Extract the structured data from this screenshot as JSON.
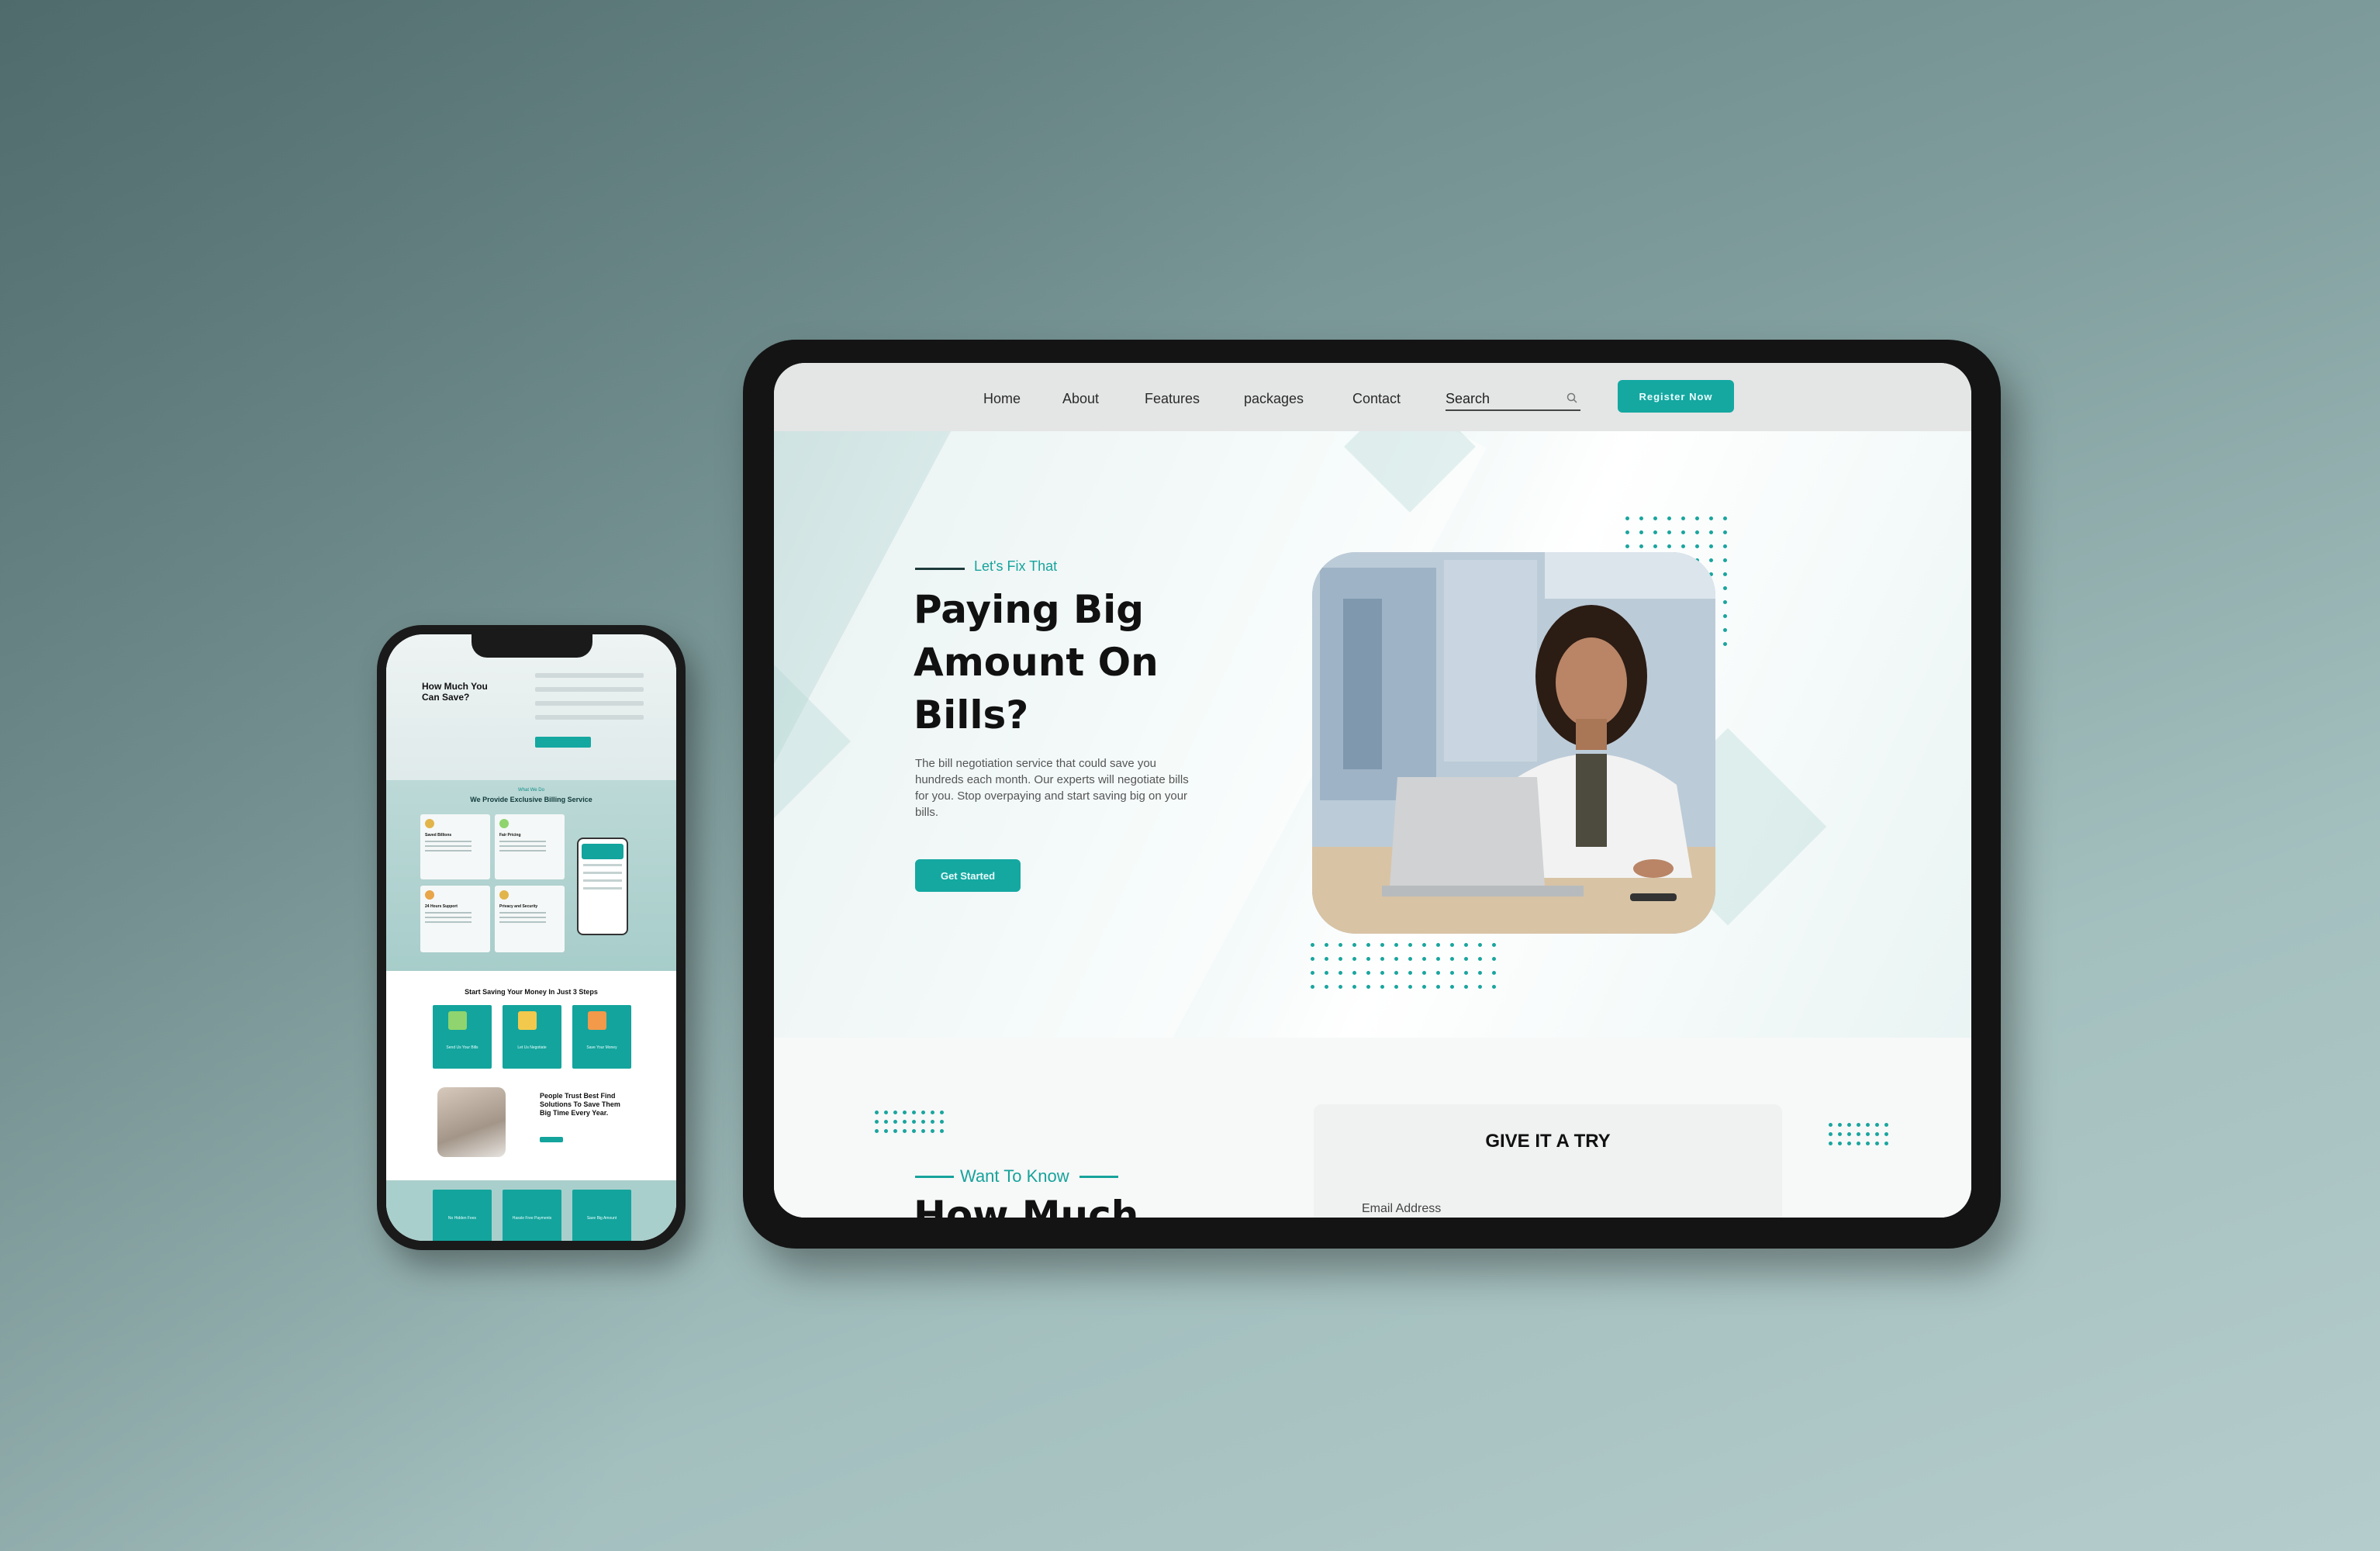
{
  "nav": {
    "items": [
      "Home",
      "About",
      "Features",
      "packages",
      "Contact"
    ],
    "search_label": "Search",
    "register_label": "Register Now"
  },
  "hero": {
    "eyebrow": "Let's Fix That",
    "title": "Paying Big Amount On Bills?",
    "text": "The bill negotiation service that could save you hundreds each month. Our experts will negotiate bills for you. Stop overpaying and start saving big on your bills.",
    "button_label": "Get Started"
  },
  "section2": {
    "eyebrow": "Want To Know",
    "title_partial": "How Much",
    "form_title": "GIVE IT A TRY",
    "email_label": "Email Address"
  },
  "phone": {
    "save_title": "How Much You Can Save?",
    "services_eyebrow": "What We Do",
    "services_title": "We Provide Exclusive Billing Service",
    "service_cards": [
      "Saved Billions",
      "Fair Pricing",
      "24 Hours Support",
      "Privacy and Security"
    ],
    "steps_title": "Start Saving Your Money In Just 3 Steps",
    "steps": [
      "Send Us Your Bills",
      "Let Us Negotiate",
      "Save Your Money"
    ],
    "trust_title": "People Trust Best Find Solutions To Save Them Big Time Every Year.",
    "bottom_cards": [
      "No Hidden Fees",
      "Hassle Free Payments",
      "Save Big Amount"
    ]
  },
  "colors": {
    "accent": "#14a8a1",
    "background": "#8aa8a7",
    "device": "#141414"
  }
}
